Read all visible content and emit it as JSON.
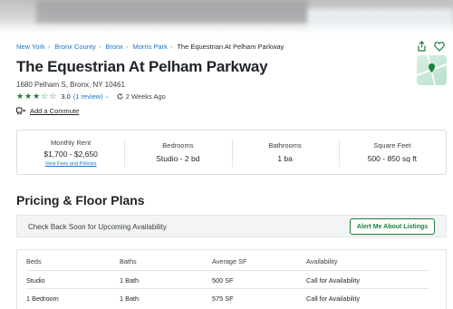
{
  "breadcrumb": [
    "New York",
    "Bronx County",
    "Bronx",
    "Morris Park"
  ],
  "breadcrumb_current": "The Equestrian At Pelham Parkway",
  "listing": {
    "title": "The Equestrian At Pelham Parkway",
    "address": "1680 Pelham S, Bronx, NY 10461",
    "rating": "3.0",
    "rating_stars": 3,
    "reviews_link": "(1 review)",
    "updated": "2 Weeks Ago",
    "commute_link": "Add a Commute"
  },
  "facts": {
    "rent_label": "Monthly Rent",
    "rent_value": "$1,700 - $2,650",
    "fees_link": "View Fees and Policies",
    "beds_label": "Bedrooms",
    "beds_value": "Studio - 2 bd",
    "baths_label": "Bathrooms",
    "baths_value": "1 ba",
    "sqft_label": "Square Feet",
    "sqft_value": "500 - 850 sq ft"
  },
  "pricing": {
    "section_title": "Pricing & Floor Plans",
    "availability_text": "Check Back Soon for Upcoming Availability",
    "alert_button": "Alert Me About Listings"
  },
  "floorplan_table": {
    "headers": [
      "Beds",
      "Baths",
      "Average SF",
      "Availability"
    ],
    "rows": [
      [
        "Studio",
        "1 Bath",
        "500 SF",
        "Call for Availability"
      ],
      [
        "1 Bedroom",
        "1 Bath",
        "575 SF",
        "Call for Availability"
      ]
    ]
  },
  "colors": {
    "link": "#1a73c8",
    "accent_green": "#1a7f3c"
  },
  "icons": [
    "share-icon",
    "heart-icon",
    "map-pin-icon",
    "refresh-icon",
    "commute-icon",
    "chevron-down-icon"
  ]
}
